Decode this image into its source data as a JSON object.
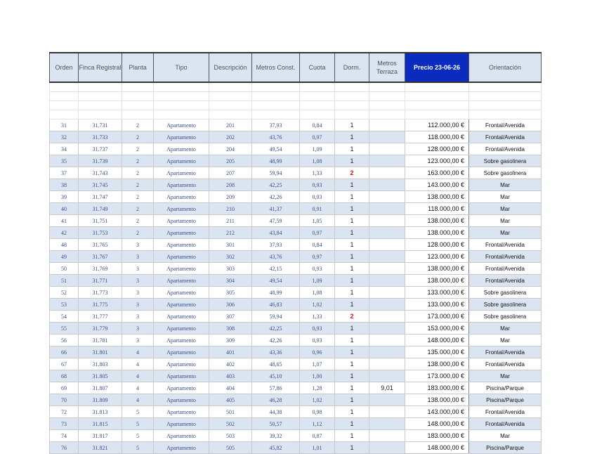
{
  "table": {
    "headers": [
      "Orden",
      "Finca Registral",
      "Planta",
      "Tipo",
      "Descripción",
      "Metros Const.",
      "Cuota",
      "Dorm.",
      "Metros Terraza",
      "Precio 23-06-26",
      "Orientación"
    ],
    "rows": [
      [
        "31",
        "31.731",
        "2",
        "Apartamento",
        "201",
        "37,93",
        "0,84",
        "1",
        "",
        "112.000,00 €",
        "Frontal/Avenida"
      ],
      [
        "32",
        "31.733",
        "2",
        "Apartamento",
        "202",
        "43,76",
        "0,97",
        "1",
        "",
        "118.000,00 €",
        "Frontal/Avenida"
      ],
      [
        "34",
        "31.737",
        "2",
        "Apartamento",
        "204",
        "49,54",
        "1,09",
        "1",
        "",
        "128.000,00 €",
        "Frontal/Avenida"
      ],
      [
        "35",
        "31.739",
        "2",
        "Apartamento",
        "205",
        "48,99",
        "1,08",
        "1",
        "",
        "123.000,00 €",
        "Sobre gasolinera"
      ],
      [
        "37",
        "31.743",
        "2",
        "Apartamento",
        "207",
        "59,94",
        "1,33",
        "2",
        "",
        "163.000,00 €",
        "Sobre gasolinera"
      ],
      [
        "38",
        "31.745",
        "2",
        "Apartamento",
        "208",
        "42,25",
        "0,93",
        "1",
        "",
        "143.000,00 €",
        "Mar"
      ],
      [
        "39",
        "31.747",
        "2",
        "Apartamento",
        "209",
        "42,26",
        "0,93",
        "1",
        "",
        "138.000,00 €",
        "Mar"
      ],
      [
        "40",
        "31.749",
        "2",
        "Apartamento",
        "210",
        "41,37",
        "0,91",
        "1",
        "",
        "118.000,00 €",
        "Mar"
      ],
      [
        "41",
        "31.751",
        "2",
        "Apartamento",
        "211",
        "47,59",
        "1,05",
        "1",
        "",
        "138.000,00 €",
        "Mar"
      ],
      [
        "42",
        "31.753",
        "2",
        "Apartamento",
        "212",
        "43,84",
        "0,97",
        "1",
        "",
        "138.000,00 €",
        "Mar"
      ],
      [
        "48",
        "31.765",
        "3",
        "Apartamento",
        "301",
        "37,93",
        "0,84",
        "1",
        "",
        "128.000,00 €",
        "Frontal/Avenida"
      ],
      [
        "49",
        "31.767",
        "3",
        "Apartamento",
        "302",
        "43,76",
        "0,97",
        "1",
        "",
        "123.000,00 €",
        "Frontal/Avenida"
      ],
      [
        "50",
        "31.769",
        "3",
        "Apartamento",
        "303",
        "42,15",
        "0,93",
        "1",
        "",
        "138.000,00 €",
        "Frontal/Avenida"
      ],
      [
        "51",
        "31.771",
        "3",
        "Apartamento",
        "304",
        "49,54",
        "1,09",
        "1",
        "",
        "138.000,00 €",
        "Frontal/Avenida"
      ],
      [
        "52",
        "31.773",
        "3",
        "Apartamento",
        "305",
        "48,99",
        "1,08",
        "1",
        "",
        "133.000,00 €",
        "Sobre gasolinera"
      ],
      [
        "53",
        "31.775",
        "3",
        "Apartamento",
        "306",
        "46,83",
        "1,02",
        "1",
        "",
        "133.000,00 €",
        "Sobre gasolinera"
      ],
      [
        "54",
        "31.777",
        "3",
        "Apartamento",
        "307",
        "59,94",
        "1,33",
        "2",
        "",
        "173.000,00 €",
        "Sobre gasolinera"
      ],
      [
        "55",
        "31.779",
        "3",
        "Apartamento",
        "308",
        "42,25",
        "0,93",
        "1",
        "",
        "153.000,00 €",
        "Mar"
      ],
      [
        "56",
        "31.781",
        "3",
        "Apartamento",
        "309",
        "42,26",
        "0,93",
        "1",
        "",
        "148.000,00 €",
        "Mar"
      ],
      [
        "66",
        "31.801",
        "4",
        "Apartamento",
        "401",
        "43,36",
        "0,96",
        "1",
        "",
        "135.000,00 €",
        "Frontal/Avenida"
      ],
      [
        "67",
        "31.803",
        "4",
        "Apartamento",
        "402",
        "48,65",
        "1,07",
        "1",
        "",
        "138.000,00 €",
        "Frontal/Avenida"
      ],
      [
        "68",
        "31.805",
        "4",
        "Apartamento",
        "403",
        "45,10",
        "1,00",
        "1",
        "",
        "173.000,00 €",
        "Mar"
      ],
      [
        "69",
        "31.807",
        "4",
        "Apartamento",
        "404",
        "57,86",
        "1,28",
        "1",
        "9,01",
        "183.000,00 €",
        "Piscina/Parque"
      ],
      [
        "70",
        "31.809",
        "4",
        "Apartamento",
        "405",
        "46,28",
        "1,02",
        "1",
        "",
        "138.000,00 €",
        "Piscina/Parque"
      ],
      [
        "72",
        "31.813",
        "5",
        "Apartamento",
        "501",
        "44,38",
        "0,98",
        "1",
        "",
        "143.000,00 €",
        "Frontal/Avenida"
      ],
      [
        "73",
        "31.815",
        "5",
        "Apartamento",
        "502",
        "50,57",
        "1,12",
        "1",
        "",
        "148.000,00 €",
        "Frontal/Avenida"
      ],
      [
        "74",
        "31.817",
        "5",
        "Apartamento",
        "503",
        "39,32",
        "0,87",
        "1",
        "",
        "183.000,00 €",
        "Mar"
      ],
      [
        "76",
        "31.821",
        "5",
        "Apartamento",
        "505",
        "45,82",
        "1,01",
        "1",
        "",
        "148.000,00 €",
        "Piscina/Parque"
      ]
    ]
  }
}
